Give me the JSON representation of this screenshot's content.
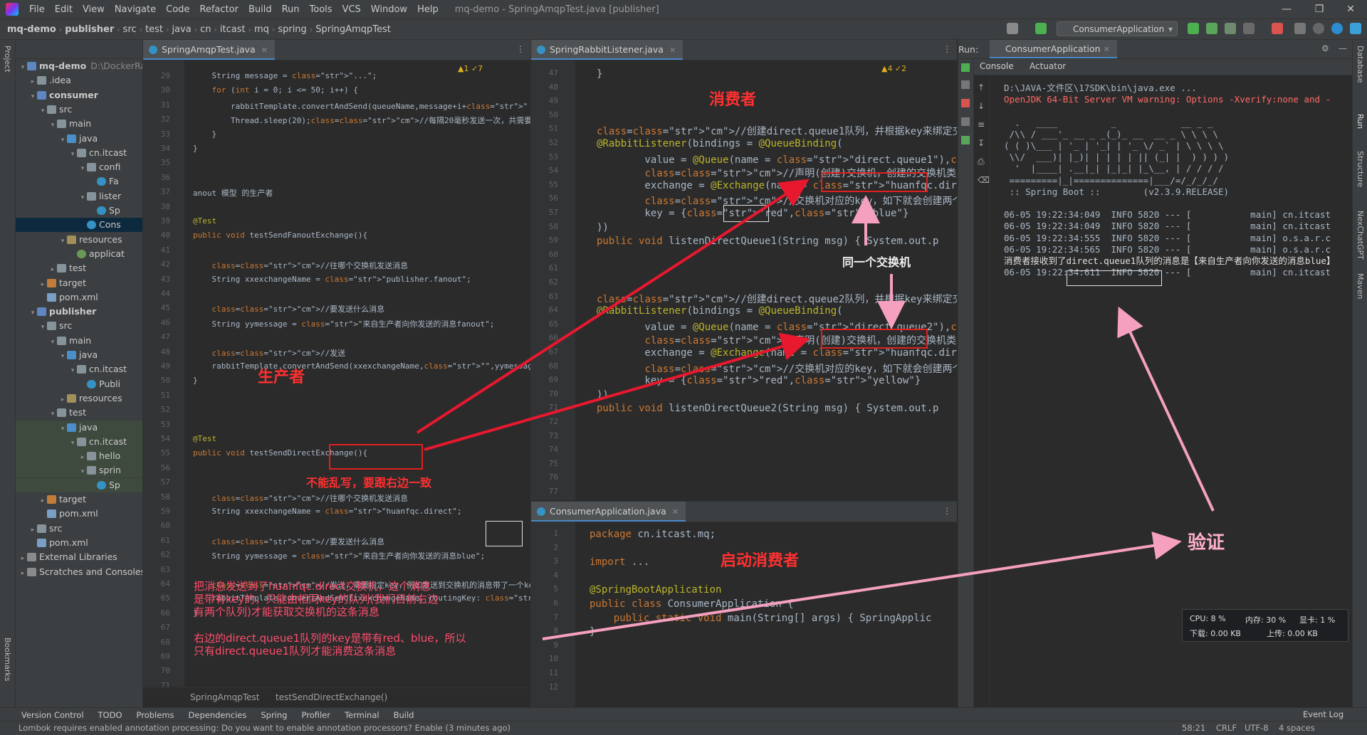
{
  "menubar": {
    "items": [
      "File",
      "Edit",
      "View",
      "Navigate",
      "Code",
      "Refactor",
      "Build",
      "Run",
      "Tools",
      "VCS",
      "Window",
      "Help"
    ],
    "title": "mq-demo - SpringAmqpTest.java [publisher]"
  },
  "navbar": {
    "crumbs": [
      "mq-demo",
      "publisher",
      "src",
      "test",
      "java",
      "cn",
      "itcast",
      "mq",
      "spring",
      "SpringAmqpTest"
    ],
    "run_config": "ConsumerApplication"
  },
  "side": {
    "project": "Project",
    "bookmarks": "Bookmarks",
    "database": "Database",
    "run": "Run",
    "structure": "Structure",
    "nexchat": "NexChatGPT",
    "maven": "Maven"
  },
  "tree": [
    {
      "label": "mq-demo",
      "suffix": "D:\\DockerRa",
      "depth": 0,
      "icon": "mod",
      "open": true,
      "bold": true
    },
    {
      "label": ".idea",
      "depth": 1,
      "icon": "folder",
      "open": false
    },
    {
      "label": "consumer",
      "depth": 1,
      "icon": "mod",
      "open": true,
      "bold": true
    },
    {
      "label": "src",
      "depth": 2,
      "icon": "folder",
      "open": true
    },
    {
      "label": "main",
      "depth": 3,
      "icon": "folder",
      "open": true
    },
    {
      "label": "java",
      "depth": 4,
      "icon": "src",
      "open": true
    },
    {
      "label": "cn.itcast",
      "depth": 5,
      "icon": "folder",
      "open": true
    },
    {
      "label": "confi",
      "depth": 6,
      "icon": "folder",
      "open": true
    },
    {
      "label": "Fa",
      "depth": 7,
      "icon": "cls"
    },
    {
      "label": "lister",
      "depth": 6,
      "icon": "folder",
      "open": true
    },
    {
      "label": "Sp",
      "depth": 7,
      "icon": "cls"
    },
    {
      "label": "Cons",
      "depth": 6,
      "icon": "cls",
      "sel": true
    },
    {
      "label": "resources",
      "depth": 4,
      "icon": "res",
      "open": true
    },
    {
      "label": "applicat",
      "depth": 5,
      "icon": "leaf"
    },
    {
      "label": "test",
      "depth": 3,
      "icon": "folder",
      "open": false
    },
    {
      "label": "target",
      "depth": 2,
      "icon": "tgt",
      "open": false
    },
    {
      "label": "pom.xml",
      "depth": 2,
      "icon": "xml"
    },
    {
      "label": "publisher",
      "depth": 1,
      "icon": "mod",
      "open": true,
      "bold": true
    },
    {
      "label": "src",
      "depth": 2,
      "icon": "folder",
      "open": true
    },
    {
      "label": "main",
      "depth": 3,
      "icon": "folder",
      "open": true
    },
    {
      "label": "java",
      "depth": 4,
      "icon": "src",
      "open": true
    },
    {
      "label": "cn.itcast",
      "depth": 5,
      "icon": "folder",
      "open": true
    },
    {
      "label": "Publi",
      "depth": 6,
      "icon": "cls"
    },
    {
      "label": "resources",
      "depth": 4,
      "icon": "res",
      "open": false
    },
    {
      "label": "test",
      "depth": 3,
      "icon": "folder",
      "open": true
    },
    {
      "label": "java",
      "depth": 4,
      "icon": "src",
      "open": true,
      "green": true
    },
    {
      "label": "cn.itcast",
      "depth": 5,
      "icon": "folder",
      "open": true,
      "green": true
    },
    {
      "label": "hello",
      "depth": 6,
      "icon": "folder",
      "open": false,
      "green": true
    },
    {
      "label": "sprin",
      "depth": 6,
      "icon": "folder",
      "open": true,
      "green": true
    },
    {
      "label": "Sp",
      "depth": 7,
      "icon": "cls",
      "green": true
    },
    {
      "label": "target",
      "depth": 2,
      "icon": "tgt",
      "open": false
    },
    {
      "label": "pom.xml",
      "depth": 2,
      "icon": "xml"
    },
    {
      "label": "src",
      "depth": 1,
      "icon": "folder",
      "open": false
    },
    {
      "label": "pom.xml",
      "depth": 1,
      "icon": "xml"
    },
    {
      "label": "External Libraries",
      "depth": 0,
      "icon": "lib",
      "open": false
    },
    {
      "label": "Scratches and Consoles",
      "depth": 0,
      "icon": "lib",
      "open": false
    }
  ],
  "editor1": {
    "tab": "SpringAmqpTest.java",
    "warn": "▲1  ✓7",
    "breadcrumb": [
      "SpringAmqpTest",
      "testSendDirectExchange()"
    ],
    "first_line": 29,
    "lines": [
      "    String message = \"...\";",
      "    for (int i = 0; i <= 50; i++) {",
      "        rabbitTemplate.convertAndSend(queueName,message+i+\" 条消息\");",
      "        Thread.sleep(20);//每隔20毫秒发送一次，共需要1秒才能发完50条消息",
      "    }",
      "}",
      "",
      "",
      "anout 模型 的生产者",
      "",
      "@Test",
      "public void testSendFanoutExchange(){",
      "",
      "    //往哪个交换机发送消息",
      "    String xxexchangeName = \"publisher.fanout\";",
      "",
      "    //要发送什么消息",
      "    String yymessage = \"来自生产者向你发送的消息fanout\";",
      "",
      "    //发送",
      "    rabbitTemplate.convertAndSend(xxexchangeName,\"\",yymessage);",
      "}",
      "",
      "",
      "",
      "@Test",
      "public void testSendDirectExchange(){",
      "",
      "",
      "    //往哪个交换机发送消息",
      "    String xxexchangeName = \"huanfqc.direct\";",
      "",
      "    //要发送什么消息",
      "    String yymessage = \"来自生产者向你发送的消息blue\";",
      "",
      "    //发送，需要指定key，例如发送到交换机的消息带了一个key为blue的消息，只有",
      "    rabbitTemplate.convertAndSend(xxexchangeName, routingKey: \"blue\", yy",
      "}",
      "",
      "",
      "",
      "",
      ""
    ]
  },
  "editor2": {
    "tab": "SpringRabbitListener.java",
    "warn": "▲4  ✓2",
    "first_line": 47,
    "lines": [
      "}",
      "",
      "",
      "",
      "//创建direct.queue1队列，并根据key来绑定交换机",
      "@RabbitListener(bindings = @QueueBinding(",
      "        value = @Queue(name = \"direct.queue1\"),//声明(创建",
      "        //声明(创建)交换机，创建的交换机类型是DIRECT",
      "        exchange = @Exchange(name = \"huanfqc.direct\",type",
      "        //交换机对应的key，如下就会创建两个不同key的队列，分别是key",
      "        key = {\"red\",\"blue\"}",
      "))",
      "public void listenDirectQueue1(String msg) { System.out.p",
      "",
      "",
      "",
      "//创建direct.queue2队列，并根据key来绑定交换机",
      "@RabbitListener(bindings = @QueueBinding(",
      "        value = @Queue(name = \"direct.queue2\"),//声明(创建",
      "        //声明(创建)交换机，创建的交换机类型是DIRECT",
      "        exchange = @Exchange(name = \"huanfqc.direct\",type",
      "        //交换机对应的key，如下就会创建两个不同key的队列，分别是key",
      "        key = {\"red\",\"yellow\"}",
      "))",
      "public void listenDirectQueue2(String msg) { System.out.p",
      "",
      "",
      "",
      "",
      "",
      "",
      ""
    ],
    "last_line": 79
  },
  "editor3": {
    "tab": "ConsumerApplication.java",
    "first_line": 1,
    "lines": [
      "package cn.itcast.mq;",
      "",
      "import ...",
      "",
      "@SpringBootApplication",
      "public class ConsumerApplication {",
      "    public static void main(String[] args) { SpringApplic",
      "}",
      "",
      "",
      "",
      ""
    ]
  },
  "run": {
    "label": "Run:",
    "tab": "ConsumerApplication",
    "console_tab": "Console",
    "actuator_tab": "Actuator",
    "lines": [
      "D:\\JAVA-文件区\\17SDK\\bin\\java.exe ...",
      "OpenJDK 64-Bit Server VM warning: Options -Xverify:none and -",
      "",
      "  .   ____          _            __ _ _",
      " /\\\\ / ___'_ __ _ _(_)_ __  __ _ \\ \\ \\ \\",
      "( ( )\\___ | '_ | '_| | '_ \\/ _` | \\ \\ \\ \\",
      " \\\\/  ___)| |_)| | | | | || (_| |  ) ) ) )",
      "  '  |____| .__|_| |_|_| |_\\__, | / / / /",
      " =========|_|==============|___/=/_/_/_/",
      " :: Spring Boot ::        (v2.3.9.RELEASE)",
      "",
      "06-05 19:22:34:049  INFO 5820 --- [           main] cn.itcast",
      "06-05 19:22:34:049  INFO 5820 --- [           main] cn.itcast",
      "06-05 19:22:34:555  INFO 5820 --- [           main] o.s.a.r.c",
      "06-05 19:22:34:565  INFO 5820 --- [           main] o.s.a.r.c",
      "消费者接收到了direct.queue1队列的消息是【来自生产者向你发送的消息blue】",
      "06-05 19:22:34:611  INFO 5820 --- [           main] cn.itcast"
    ],
    "perf": {
      "cpu": "CPU: 8 %",
      "mem": "内存: 30 %",
      "gpu": "显卡: 1 %",
      "down": "下载: 0.00 KB",
      "up": "上传: 0.00 KB"
    }
  },
  "annotations": {
    "consumer": "消费者",
    "producer": "生产者",
    "same_exchange": "同一个交换机",
    "no_random": "不能乱写，要跟右边一致",
    "start_consumer": "启动消费者",
    "verify": "验证",
    "explain1": "把消息发送到了huanfqc.direct交换机，这个消息\n是带有key的，只能由相同key的队列(我们目前右边\n有两个队列)才能获取交换机的这条消息",
    "explain2": "右边的direct.queue1队列的key是带有red、blue，所以\n只有direct.queue1队列才能消费这条消息"
  },
  "bottom_tools": [
    "Version Control",
    "TODO",
    "Problems",
    "Dependencies",
    "Spring",
    "Profiler",
    "Terminal",
    "Build"
  ],
  "event_log": "Event Log",
  "status": {
    "message": "Lombok requires enabled annotation processing: Do you want to enable annotation processors? Enable (3 minutes ago)",
    "position": "58:21",
    "line_sep": "CRLF",
    "encoding": "UTF-8",
    "indent": "4 spaces"
  }
}
